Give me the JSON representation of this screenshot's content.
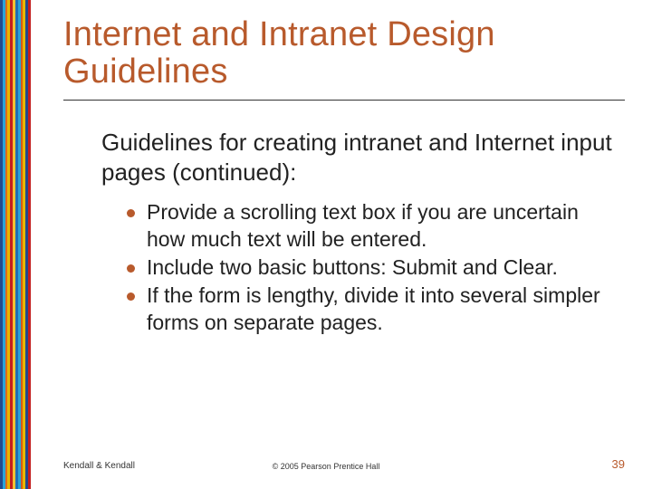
{
  "title": "Internet and Intranet Design Guidelines",
  "subhead": "Guidelines for creating intranet and Internet input pages (continued):",
  "bullets": [
    "Provide a scrolling text box if you are uncertain how much text will be entered.",
    "Include two basic buttons: Submit and Clear.",
    "If the form is lengthy, divide it into several simpler forms on separate pages."
  ],
  "footer": {
    "left": "Kendall & Kendall",
    "center": "© 2005 Pearson Prentice Hall",
    "page": "39"
  },
  "stripe_colors": [
    "#204a8f",
    "#2aa3d8",
    "#e06a1a",
    "#e6b800",
    "#c41f1f",
    "#f2c233",
    "#1f6fb5",
    "#2aa3d8",
    "#d85c15",
    "#e6b800",
    "#204a8f",
    "#c41f1f"
  ]
}
